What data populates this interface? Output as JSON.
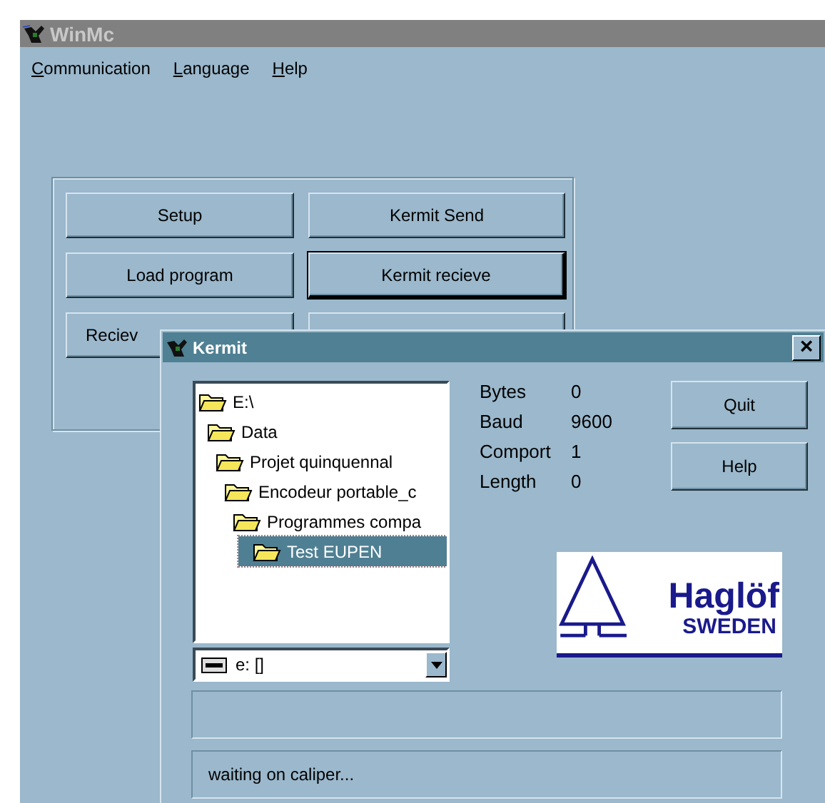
{
  "window": {
    "title": "WinMc"
  },
  "menu": [
    {
      "label": "Communication"
    },
    {
      "label": "Language"
    },
    {
      "label": "Help"
    }
  ],
  "buttons": [
    {
      "kind": "labeled",
      "label": "Setup",
      "default": false
    },
    {
      "kind": "labeled",
      "label": "Kermit Send",
      "default": false
    },
    {
      "kind": "labeled",
      "label": "Load program",
      "default": false
    },
    {
      "kind": "labeled",
      "label": "Kermit recieve",
      "default": true
    },
    {
      "kind": "covered",
      "label": "Reciev",
      "default": false
    },
    {
      "kind": "blank",
      "default": false
    }
  ],
  "dialog": {
    "title": "Kermit",
    "close": "×",
    "tree": [
      {
        "label": "E:\\",
        "selected": false,
        "children": [
          {
            "label": "Data",
            "selected": false,
            "children": [
              {
                "label": "Projet quinquennal",
                "selected": false,
                "children": [
                  {
                    "label": "Encodeur portable_c",
                    "selected": false,
                    "children": [
                      {
                        "label": "Programmes compa",
                        "selected": false,
                        "children": [
                          {
                            "label": "Test EUPEN",
                            "selected": true
                          }
                        ]
                      }
                    ]
                  }
                ]
              }
            ]
          }
        ]
      }
    ],
    "drive": {
      "value": "e: []"
    },
    "info": [
      {
        "label": "Bytes",
        "value": "0"
      },
      {
        "label": "Baud",
        "value": "9600"
      },
      {
        "label": "Comport",
        "value": "1"
      },
      {
        "label": "Length",
        "value": "0"
      }
    ],
    "buttons": [
      "Quit",
      "Help"
    ],
    "logo": {
      "name": "Haglöf",
      "country": "SWEDEN"
    },
    "status": "waiting on caliper..."
  }
}
